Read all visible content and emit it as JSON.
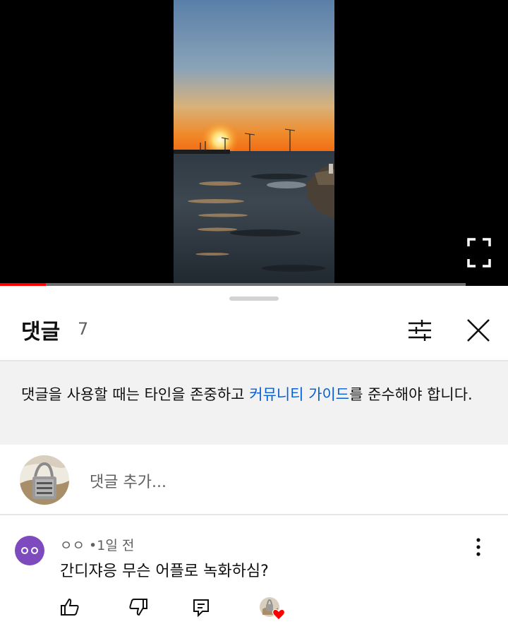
{
  "player": {
    "progress_fraction": 0.09
  },
  "comments_panel": {
    "title": "댓글",
    "count": "7",
    "guideline_prefix": "댓글을 사용할 때는 타인을 존중하고 ",
    "guideline_link": "커뮤니티 가이드",
    "guideline_suffix": "를 준수해야 합니다.",
    "add_comment_placeholder": "댓글 추가..."
  },
  "comments": [
    {
      "author": "ㅇㅇ",
      "separator": "•",
      "time": "1일 전",
      "text": "간디쟈응 무슨 어플로 녹화하심?"
    }
  ],
  "colors": {
    "accent_red": "#ff0000",
    "link_blue": "#065fd4",
    "avatar_purple": "#7e4bbf"
  },
  "icons": [
    "fullscreen-icon",
    "filter-icon",
    "close-icon",
    "more-vert-icon",
    "like-icon",
    "dislike-icon",
    "reply-icon",
    "heart-icon"
  ]
}
